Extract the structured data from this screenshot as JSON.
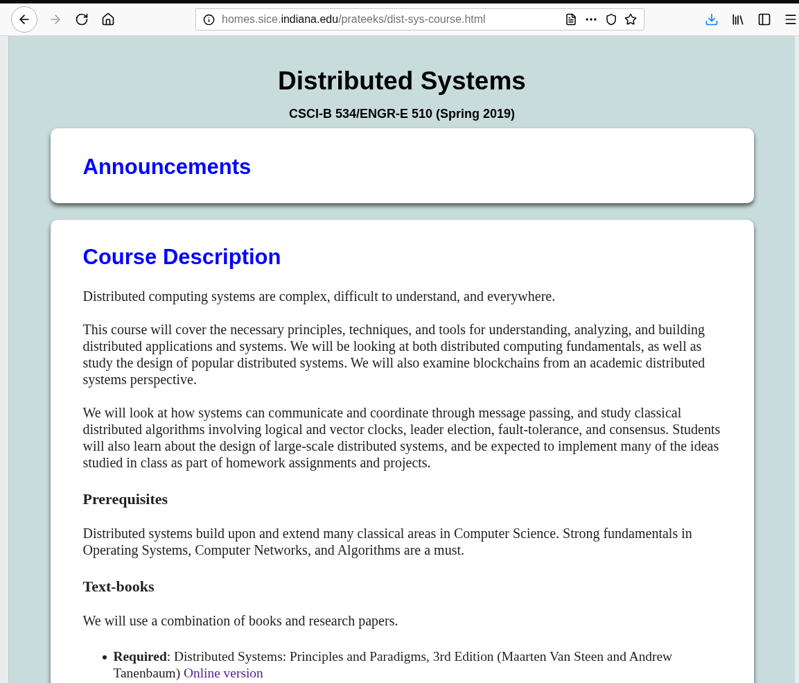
{
  "browser": {
    "url": "homes.sice.**indiana.edu**/prateeks/dist-sys-course.html"
  },
  "page": {
    "title": "Distributed Systems",
    "subtitle": "CSCI-B 534/ENGR-E 510 (Spring 2019)"
  },
  "announcements": {
    "heading": "Announcements"
  },
  "course_description": {
    "heading": "Course Description",
    "blocks": [
      {
        "kind": "paragraph",
        "text": "Distributed computing systems are complex, difficult to understand, and everywhere."
      },
      {
        "kind": "paragraph",
        "text": "This course will cover the necessary principles, techniques, and tools for understanding, analyzing, and building distributed applications and systems. We will be looking at both distributed computing fundamentals, as well as study the design of popular distributed systems. We will also examine blockchains from an academic distributed systems perspective."
      },
      {
        "kind": "paragraph",
        "text": "We will look at how systems can communicate and coordinate through message passing, and study classical distributed algorithms involving logical and vector clocks, leader election, fault-tolerance, and consensus. Students will also learn about the design of large-scale distributed systems, and be expected to implement many of the ideas studied in class as part of homework assignments and projects."
      },
      {
        "kind": "heading",
        "text": "Prerequisites"
      },
      {
        "kind": "paragraph",
        "text": "Distributed systems build upon and extend many classical areas in Computer Science. Strong fundamentals in Operating Systems, Computer Networks, and Algorithms are a must."
      },
      {
        "kind": "heading",
        "text": "Text-books"
      },
      {
        "kind": "paragraph",
        "text": "We will use a combination of books and research papers."
      },
      {
        "kind": "bullet",
        "text": "**Required**: Distributed Systems: Principles and Paradigms, 3rd Edition (Maarten Van Steen and Andrew Tanenbaum)",
        "link": "Online version"
      }
    ]
  }
}
